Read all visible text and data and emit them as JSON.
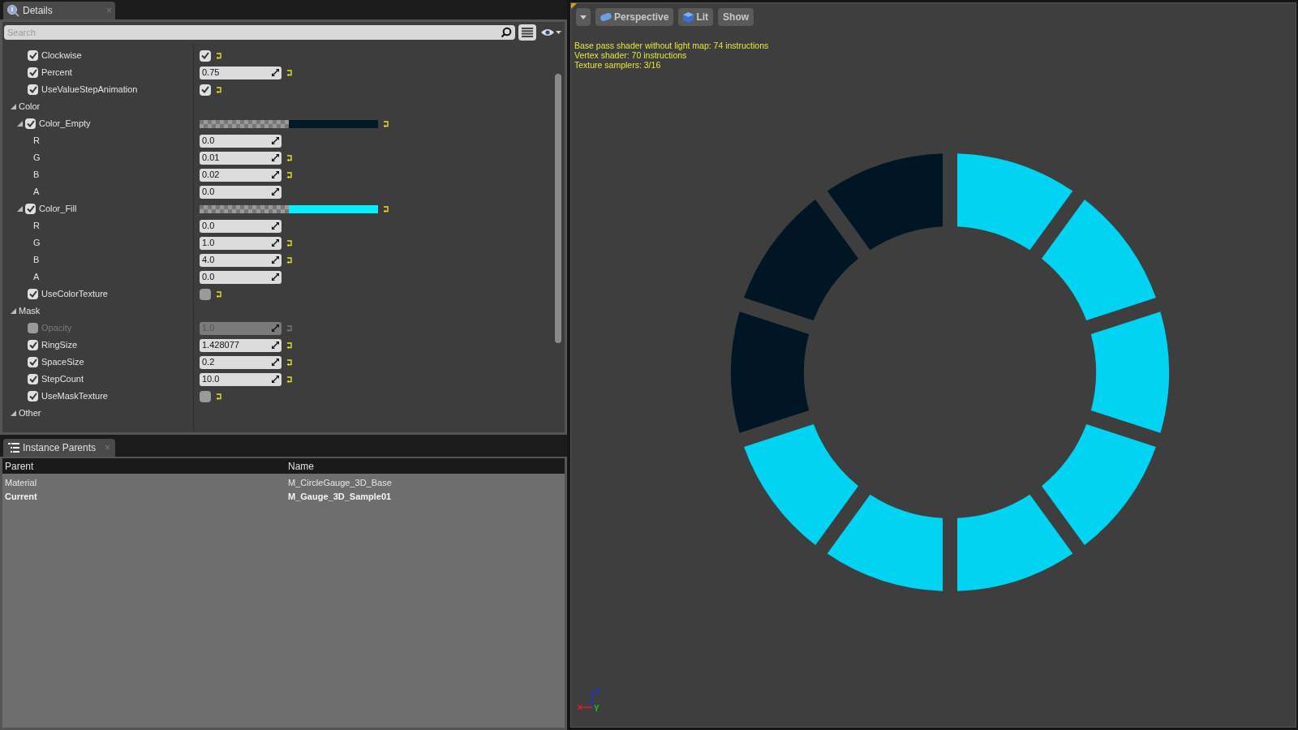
{
  "details": {
    "tab": {
      "title": "Details",
      "close": "×"
    },
    "search": {
      "placeholder": "Search"
    },
    "properties": [
      {
        "kind": "bool",
        "label": "Clockwise",
        "override": true,
        "checked": true,
        "modified": true
      },
      {
        "kind": "number",
        "label": "Percent",
        "override": true,
        "value": "0.75",
        "modified": true
      },
      {
        "kind": "bool",
        "label": "UseValueStepAnimation",
        "override": true,
        "checked": true,
        "modified": true
      },
      {
        "kind": "section",
        "label": "Color",
        "expanded": true,
        "children": [
          {
            "kind": "color",
            "label": "Color_Empty",
            "override": true,
            "expanded": true,
            "color": "#001a26",
            "modified": true,
            "children": [
              {
                "kind": "number",
                "label": "R",
                "value": "0.0",
                "modified": false
              },
              {
                "kind": "number",
                "label": "G",
                "value": "0.01",
                "modified": true
              },
              {
                "kind": "number",
                "label": "B",
                "value": "0.02",
                "modified": true
              },
              {
                "kind": "number",
                "label": "A",
                "value": "0.0",
                "modified": false
              }
            ]
          },
          {
            "kind": "color",
            "label": "Color_Fill",
            "override": true,
            "expanded": true,
            "color": "#00f2ff",
            "modified": true,
            "children": [
              {
                "kind": "number",
                "label": "R",
                "value": "0.0",
                "modified": false
              },
              {
                "kind": "number",
                "label": "G",
                "value": "1.0",
                "modified": true
              },
              {
                "kind": "number",
                "label": "B",
                "value": "4.0",
                "modified": true
              },
              {
                "kind": "number",
                "label": "A",
                "value": "0.0",
                "modified": false
              }
            ]
          },
          {
            "kind": "bool",
            "label": "UseColorTexture",
            "override": true,
            "checked": false,
            "modified": true
          }
        ]
      },
      {
        "kind": "section",
        "label": "Mask",
        "expanded": true,
        "children": [
          {
            "kind": "number",
            "label": "Opacity",
            "override": false,
            "value": "1.0",
            "modified": true
          },
          {
            "kind": "number",
            "label": "RingSize",
            "override": true,
            "value": "1.428077",
            "modified": true
          },
          {
            "kind": "number",
            "label": "SpaceSize",
            "override": true,
            "value": "0.2",
            "modified": true
          },
          {
            "kind": "number",
            "label": "StepCount",
            "override": true,
            "value": "10.0",
            "modified": true
          },
          {
            "kind": "bool",
            "label": "UseMaskTexture",
            "override": true,
            "checked": false,
            "modified": true
          }
        ]
      },
      {
        "kind": "section",
        "label": "Other",
        "expanded": true
      }
    ]
  },
  "instance_parents": {
    "tab": {
      "title": "Instance Parents",
      "close": "×"
    },
    "columns": [
      "Parent",
      "Name"
    ],
    "rows": [
      {
        "cells": [
          "Material",
          "M_CircleGauge_3D_Base"
        ],
        "current": false
      },
      {
        "cells": [
          "Current",
          "M_Gauge_3D_Sample01"
        ],
        "current": true
      }
    ]
  },
  "viewport": {
    "toolbar": [
      {
        "kind": "menu"
      },
      {
        "kind": "perspective",
        "label": "Perspective"
      },
      {
        "kind": "lit",
        "label": "Lit"
      },
      {
        "kind": "plain",
        "label": "Show"
      }
    ],
    "stats": [
      "Base pass shader without light map: 74 instructions",
      "Vertex shader: 70 instructions",
      "Texture samplers: 3/16"
    ],
    "axis_labels": [
      "Z",
      "Y"
    ]
  }
}
